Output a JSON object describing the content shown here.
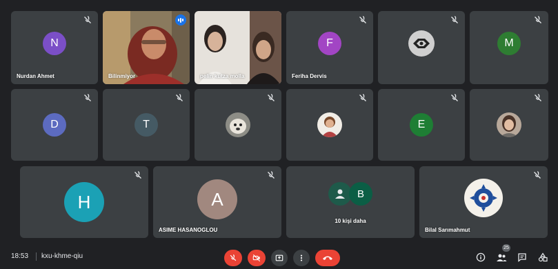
{
  "meeting": {
    "time": "18:53",
    "code": "kxu-khme-qiu"
  },
  "participants": {
    "nurdan": {
      "name": "Nurdan Ahmet",
      "initial": "N",
      "color": "#7b4fc7"
    },
    "bilinmiyor": {
      "name": "Bilinmiyor"
    },
    "pelin": {
      "name": "pelin kutza molla"
    },
    "feriha": {
      "name": "Feriha Dervis",
      "initial": "F",
      "color": "#a245c4"
    },
    "d": {
      "initial": "D",
      "color": "#5c6bc0"
    },
    "t": {
      "initial": "T",
      "color": "#455a64"
    },
    "e": {
      "initial": "E",
      "color": "#1e7e34"
    },
    "m": {
      "initial": "M",
      "color": "#2e7d32"
    },
    "h": {
      "initial": "H",
      "color": "#1ba1b5"
    },
    "asime": {
      "name": "ASIME HASANOGLOU",
      "initial": "A",
      "color": "#a1887f"
    },
    "more": {
      "label": "10 kişi daha",
      "initial": "B",
      "color": "#0b5e45"
    },
    "bilal": {
      "name": "Bilal Sarımahmut"
    }
  },
  "controls": {
    "people_count": "25",
    "accent_red": "#ea4335",
    "dark_button": "#3c4043"
  }
}
